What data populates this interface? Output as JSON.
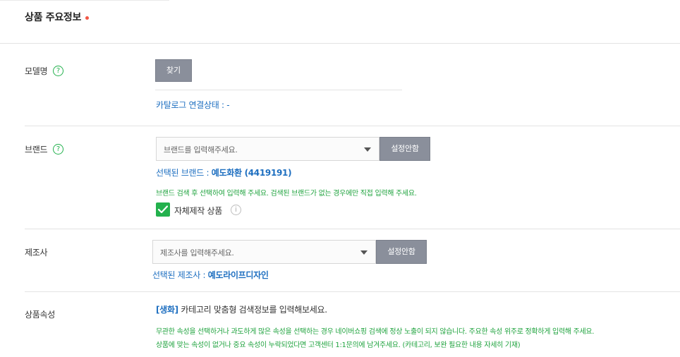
{
  "section": {
    "title": "상품 주요정보"
  },
  "model": {
    "label": "모델명",
    "help": "?",
    "find_button": "찾기",
    "catalog_status": "카탈로그 연결상태 : -"
  },
  "brand": {
    "label": "브랜드",
    "help": "?",
    "placeholder": "브랜드를 입력해주세요.",
    "button": "설정안함",
    "selected_prefix": "선택된 브랜드 : ",
    "selected_value": "예도화환 (4419191)",
    "note": "브랜드 검색 후 선택하여 입력해 주세요. 검색된 브랜드가 없는 경우에만 직접 입력해 주세요.",
    "self_made_label": "자체제작 상품",
    "info": "i"
  },
  "manufacturer": {
    "label": "제조사",
    "placeholder": "제조사를 입력해주세요.",
    "button": "설정안함",
    "selected_prefix": "선택된 제조사 : ",
    "selected_value": "예도라이프디자인"
  },
  "attributes": {
    "label": "상품속성",
    "tag": "[생화]",
    "headline": " 카테고리 맞춤형 검색정보를 입력해보세요.",
    "note_line1": "무관한 속성을 선택하거나 과도하게 많은 속성을 선택하는 경우 네이버쇼핑 검색에 정상 노출이 되지 않습니다. 주요한 속성 위주로 정확하게 입력해 주세요.",
    "note_line2": "상품에 맞는 속성이 없거나 중요 속성이 누락되었다면 고객센터 1:1문의에 남겨주세요. (카테고리, 보완 필요한 내용 자세히 기재)"
  },
  "colors": {
    "accent_blue": "#1e6fc0",
    "accent_green": "#23b14d",
    "button_gray": "#8a8f9b",
    "required_red": "#f15746"
  },
  "icons": {
    "help": "question-circle-icon",
    "info": "info-circle-icon",
    "dropdown": "caret-down-icon",
    "check": "checkmark-icon"
  }
}
